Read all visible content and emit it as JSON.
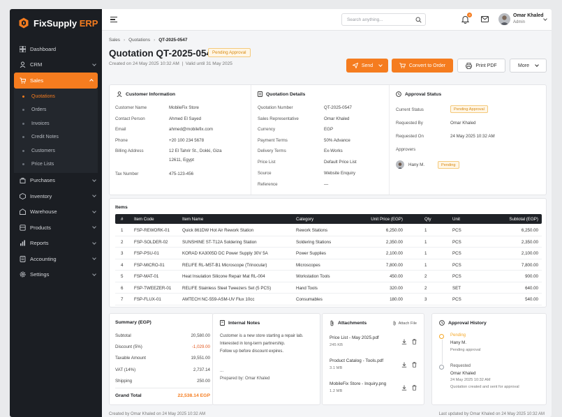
{
  "brand": {
    "name_main": "FixSupply",
    "name_accent": "ERP",
    "accent_color": "#f57c1f"
  },
  "sidebar": {
    "items": [
      {
        "label": "Dashboard",
        "icon": "dashboard-icon"
      },
      {
        "label": "CRM",
        "icon": "crm-icon"
      },
      {
        "label": "Sales",
        "icon": "sales-icon"
      },
      {
        "label": "Purchases",
        "icon": "purchases-icon"
      },
      {
        "label": "Inventory",
        "icon": "inventory-icon"
      },
      {
        "label": "Warehouse",
        "icon": "warehouse-icon"
      },
      {
        "label": "Products",
        "icon": "products-icon"
      },
      {
        "label": "Reports",
        "icon": "reports-icon"
      },
      {
        "label": "Accounting",
        "icon": "accounting-icon"
      },
      {
        "label": "Settings",
        "icon": "settings-icon"
      }
    ],
    "sales_sub": [
      "Quotations",
      "Orders",
      "Invoices",
      "Credit Notes",
      "Customers",
      "Price Lists"
    ]
  },
  "topbar": {
    "search_placeholder": "Search anything...",
    "notif_count": "3",
    "user_name": "Omar Khaled",
    "user_role": "Admin"
  },
  "breadcrumb": [
    "Sales",
    "Quotations",
    "QT-2025-0547"
  ],
  "page": {
    "title": "Quotation QT-2025-0547",
    "status": "Pending Approval",
    "created": "Created on 24 May 2025 10:32 AM",
    "valid": "Valid until 31 May 2025"
  },
  "actions": {
    "send": "Send",
    "convert": "Convert to Order",
    "print": "Print PDF",
    "more": "More"
  },
  "customer": {
    "title": "Customer Information",
    "fields": [
      {
        "k": "Customer Name",
        "v": "MobileFix Store"
      },
      {
        "k": "Contact Person",
        "v": "Ahmed El Sayed"
      },
      {
        "k": "Email",
        "v": "ahmed@mobilefix.com"
      },
      {
        "k": "Phone",
        "v": "+20 100 234 5678"
      },
      {
        "k": "Billing Address",
        "v": "12 El Tahrir St., Dokki, Giza",
        "v2": "12611, Egypt"
      },
      {
        "k": "Tax Number",
        "v": "475-123-456"
      }
    ]
  },
  "details": {
    "title": "Quotation Details",
    "fields": [
      {
        "k": "Quotation Number",
        "v": "QT-2025-0547"
      },
      {
        "k": "Sales Representative",
        "v": "Omar Khaled"
      },
      {
        "k": "Currency",
        "v": "EGP"
      },
      {
        "k": "Payment Terms",
        "v": "50% Advance"
      },
      {
        "k": "Delivery Terms",
        "v": "Ex-Works"
      },
      {
        "k": "Price List",
        "v": "Default Price List"
      },
      {
        "k": "Source",
        "v": "Website Enquiry"
      },
      {
        "k": "Reference",
        "v": "—"
      }
    ]
  },
  "approval": {
    "title": "Approval Status",
    "current_label": "Current Status",
    "current_value": "Pending Approval",
    "requested_by_label": "Requested By",
    "requested_by": "Omar Khaled",
    "requested_on_label": "Requested On",
    "requested_on": "24 May 2025 10:32 AM",
    "approvers_label": "Approvers",
    "approver": "Hany M.",
    "approver_status": "Pending"
  },
  "items": {
    "title": "Items",
    "headers": [
      "#",
      "Item Code",
      "Item Name",
      "Category",
      "Unit Price (EGP)",
      "Qty",
      "Unit",
      "Subtotal (EGP)"
    ],
    "rows": [
      [
        "1",
        "FSP-REWORK-01",
        "Quick 861DW Hot Air Rework Station",
        "Rework Stations",
        "6,250.00",
        "1",
        "PCS",
        "6,250.00"
      ],
      [
        "2",
        "FSP-SOLDER-02",
        "SUNSHINE ST-T12A Soldering Station",
        "Soldering Stations",
        "2,350.00",
        "1",
        "PCS",
        "2,350.00"
      ],
      [
        "3",
        "FSP-PSU-01",
        "KORAD KA3005D DC Power Supply 30V 5A",
        "Power Supplies",
        "2,100.00",
        "1",
        "PCS",
        "2,100.00"
      ],
      [
        "4",
        "FSP-MICRO-01",
        "RELIFE RL-M5T-B1 Microscope (Trinocular)",
        "Microscopes",
        "7,800.00",
        "1",
        "PCS",
        "7,800.00"
      ],
      [
        "5",
        "FSP-MAT-01",
        "Heat Insulation Silicone Repair Mat RL-004",
        "Workstation Tools",
        "450.00",
        "2",
        "PCS",
        "900.00"
      ],
      [
        "6",
        "FSP-TWEEZER-01",
        "RELIFE Stainless Steel Tweezers Set (5 PCS)",
        "Hand Tools",
        "320.00",
        "2",
        "SET",
        "640.00"
      ],
      [
        "7",
        "FSP-FLUX-01",
        "AMTECH NC-559-ASM-UV Flux 10cc",
        "Consumables",
        "180.00",
        "3",
        "PCS",
        "540.00"
      ]
    ]
  },
  "summary": {
    "title": "Summary (EGP)",
    "rows": [
      {
        "k": "Subtotal",
        "v": "20,580.00"
      },
      {
        "k": "Discount (5%)",
        "v": "-1,029.00"
      },
      {
        "k": "Taxable Amount",
        "v": "19,551.00"
      },
      {
        "k": "VAT (14%)",
        "v": "2,737.14"
      },
      {
        "k": "Shipping",
        "v": "250.00"
      }
    ],
    "total_label": "Grand Total",
    "total_value": "22,538.14 EGP"
  },
  "notes": {
    "title": "Internal Notes",
    "lines": [
      "Customer is a new store starting a repair lab.",
      "Interested in long-term partnership.",
      "Follow up before discount expires."
    ],
    "dots": "...",
    "prepared": "Prepared by: Omar Khaled"
  },
  "attachments": {
    "title": "Attachments",
    "attach_label": "Attach File",
    "files": [
      {
        "name": "Price List - May 2025.pdf",
        "size": "245 KB"
      },
      {
        "name": "Product Catalog - Tools.pdf",
        "size": "3.1 MB"
      },
      {
        "name": "MobileFix Store - Inquiry.png",
        "size": "1.2 MB"
      }
    ]
  },
  "history": {
    "title": "Approval History",
    "entries": [
      {
        "status": "Pending",
        "who": "Hany M.",
        "desc": "Pending approval"
      },
      {
        "status": "Requested",
        "who": "Omar Khaled",
        "time": "24 May 2025 10:32 AM",
        "desc": "Quotation created and sent for approval"
      }
    ]
  },
  "footer": {
    "created": "Created by Omar Khaled on 24 May 2025 10:32 AM",
    "updated": "Last updated by Omar Khaled on 24 May 2025 10:32 AM"
  }
}
